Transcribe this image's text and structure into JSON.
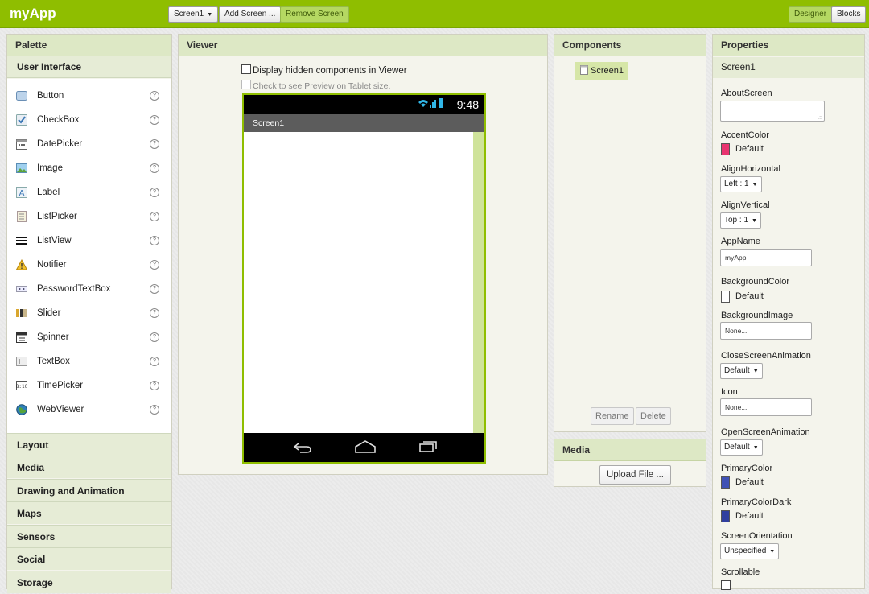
{
  "topbar": {
    "app_title": "myApp",
    "screen_select": "Screen1",
    "add_screen": "Add Screen ...",
    "remove_screen": "Remove Screen",
    "designer": "Designer",
    "blocks": "Blocks"
  },
  "palette": {
    "title": "Palette",
    "section": "User Interface",
    "items": [
      {
        "label": "Button",
        "icon": "button-icon",
        "help": "?"
      },
      {
        "label": "CheckBox",
        "icon": "checkbox-icon",
        "help": "?"
      },
      {
        "label": "DatePicker",
        "icon": "calendar-icon",
        "help": "?"
      },
      {
        "label": "Image",
        "icon": "image-icon",
        "help": "?"
      },
      {
        "label": "Label",
        "icon": "label-icon",
        "help": "?"
      },
      {
        "label": "ListPicker",
        "icon": "listpicker-icon",
        "help": "?"
      },
      {
        "label": "ListView",
        "icon": "listview-icon",
        "help": "?"
      },
      {
        "label": "Notifier",
        "icon": "warning-icon",
        "help": "?"
      },
      {
        "label": "PasswordTextBox",
        "icon": "password-icon",
        "help": "?"
      },
      {
        "label": "Slider",
        "icon": "slider-icon",
        "help": "?"
      },
      {
        "label": "Spinner",
        "icon": "spinner-icon",
        "help": "?"
      },
      {
        "label": "TextBox",
        "icon": "textbox-icon",
        "help": "?"
      },
      {
        "label": "TimePicker",
        "icon": "clock-icon",
        "help": "?"
      },
      {
        "label": "WebViewer",
        "icon": "globe-icon",
        "help": "?"
      }
    ],
    "categories": [
      "Layout",
      "Media",
      "Drawing and Animation",
      "Maps",
      "Sensors",
      "Social",
      "Storage"
    ]
  },
  "viewer": {
    "title": "Viewer",
    "show_hidden": "Display hidden components in Viewer",
    "tablet_preview": "Check to see Preview on Tablet size.",
    "phone_time": "9:48",
    "screen_title": "Screen1"
  },
  "components": {
    "title": "Components",
    "tree_root": "Screen1",
    "rename": "Rename",
    "delete": "Delete"
  },
  "media": {
    "title": "Media",
    "upload": "Upload File ..."
  },
  "properties": {
    "title": "Properties",
    "component": "Screen1",
    "about_screen": "AboutScreen",
    "accent_color": "AccentColor",
    "accent_color_value": "Default",
    "accent_hex": "#e8336f",
    "align_horizontal": "AlignHorizontal",
    "align_horizontal_value": "Left : 1",
    "align_vertical": "AlignVertical",
    "align_vertical_value": "Top : 1",
    "app_name": "AppName",
    "app_name_value": "myApp",
    "background_color": "BackgroundColor",
    "background_color_value": "Default",
    "background_image": "BackgroundImage",
    "background_image_value": "None...",
    "close_anim": "CloseScreenAnimation",
    "close_anim_value": "Default",
    "icon": "Icon",
    "icon_value": "None...",
    "open_anim": "OpenScreenAnimation",
    "open_anim_value": "Default",
    "primary_color": "PrimaryColor",
    "primary_color_value": "Default",
    "primary_hex": "#3f51b5",
    "primary_dark": "PrimaryColorDark",
    "primary_dark_value": "Default",
    "primary_dark_hex": "#303f9f",
    "orientation": "ScreenOrientation",
    "orientation_value": "Unspecified",
    "scrollable": "Scrollable"
  }
}
